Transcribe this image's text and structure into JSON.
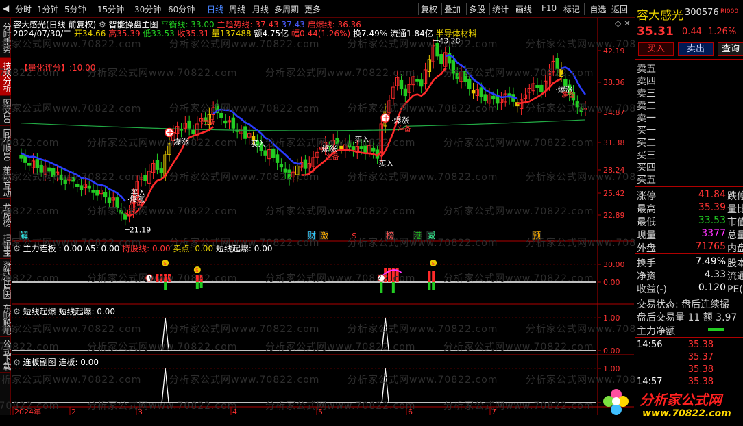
{
  "toolbar": {
    "left": [
      "分时",
      "1分钟",
      "5分钟",
      "15分钟",
      "30分钟",
      "60分钟",
      "日线",
      "周线",
      "月线",
      "多周期",
      "更多"
    ],
    "active": "日线",
    "right": [
      "复权",
      "叠加",
      "多股",
      "统计",
      "画线",
      "F10",
      "标记",
      "-自选",
      "返回"
    ]
  },
  "left_tabs": [
    "分时走势",
    "技术分析",
    "图文10",
    "同花顺10",
    "董秘互动",
    "龙虎榜",
    "扫雷宝",
    "涨跌停原因",
    "东财股吧",
    "公式下载"
  ],
  "left_active": "技术分析",
  "main_header": {
    "title": "容大感光(日线 前复权)",
    "formula": "智能操盘主图",
    "ping_label": "平衡线: 33.00",
    "trend_label": "主趋势线: 37.43",
    "mid_label": "37.43",
    "start_label": "启爆线: 36.36",
    "quote_line": [
      "2024/07/30/二",
      "开34.66",
      "高35.39",
      "低33.53",
      "收35.31",
      "量137488",
      "额4.75亿",
      "幅0.44(1.26%)",
      "换7.49%",
      "流通1.84亿",
      "半导体材料"
    ],
    "score": "【量化评分】:10.00"
  },
  "colors": {
    "up": "#ff3333",
    "down": "#22cc22",
    "axis": "#b00000",
    "bg": "#000000",
    "blue": "#2a3cff",
    "green_ma": "#22aa44"
  },
  "price_axis": [
    "42.19",
    "38.36",
    "34.87",
    "31.38",
    "28.24",
    "25.42",
    "22.89"
  ],
  "annotations": {
    "max_price": "43.20",
    "min_price": "21.19",
    "buy_text": "买入",
    "zhang_text": "爆涨",
    "zhun_text": "准备"
  },
  "event_tags": [
    "解",
    "财",
    "激",
    "$",
    "榜",
    "港",
    "减",
    "预"
  ],
  "sub1": {
    "title": "主力连板",
    "l1": ": 0.00",
    "l2": "A5: 0.00",
    "l3": "持股线: 0.00",
    "l4": "卖点: 0.00",
    "l5": "短线起爆: 0.00",
    "axis": [
      "30.00",
      "0.00"
    ]
  },
  "sub2": {
    "title": "短线起爆",
    "l1": "短线起爆: 0.00",
    "axis": [
      "1.00",
      "0.00"
    ]
  },
  "sub3": {
    "title": "连板副图",
    "l1": "连板: 0.00",
    "axis": [
      "1.00",
      "0.00"
    ]
  },
  "time_axis": [
    "2024年",
    "2",
    "3",
    "4",
    "5",
    "6",
    "7"
  ],
  "watermark": "分析家公式网www.70822.com",
  "right_panel": {
    "name": "容大感光",
    "code": "300576",
    "flag": "RI000",
    "price": "35.31",
    "change": "0.44",
    "pct": "1.26%",
    "btn_buy": "买入",
    "btn_sell": "卖出",
    "btn_query": "查询",
    "book": [
      "卖五",
      "卖四",
      "卖三",
      "卖二",
      "卖一",
      "买一",
      "买二",
      "买三",
      "买四",
      "买五"
    ],
    "stats": [
      {
        "l": "涨停",
        "v": "41.84",
        "x": "跌停",
        "c": "red"
      },
      {
        "l": "最高",
        "v": "35.39",
        "x": "量比",
        "c": "red"
      },
      {
        "l": "最低",
        "v": "33.53",
        "x": "市值",
        "c": "grn"
      },
      {
        "l": "现量",
        "v": "3377",
        "x": "总量",
        "c": "mag"
      },
      {
        "l": "外盘",
        "v": "71765",
        "x": "内盘",
        "c": "red"
      }
    ],
    "stats2": [
      {
        "l": "换手",
        "v": "7.49%",
        "x": "股本",
        "c": "wht"
      },
      {
        "l": "净资",
        "v": "4.33",
        "x": "流通",
        "c": "wht"
      },
      {
        "l": "收益(-)",
        "v": "0.120",
        "x": "PE(动",
        "c": "wht"
      }
    ],
    "state": "交易状态: 盘后连续撮",
    "after": "盘后交易量 11  额 3.97",
    "netflow": "主力净额",
    "ticks": [
      {
        "t": "14:56",
        "p": "35.38"
      },
      {
        "t": "",
        "p": "35.37"
      },
      {
        "t": "",
        "p": "35.38"
      },
      {
        "t": "14:57",
        "p": "35.38"
      }
    ],
    "logo": "分析家公式网",
    "logo_url": "www.70822.com"
  }
}
